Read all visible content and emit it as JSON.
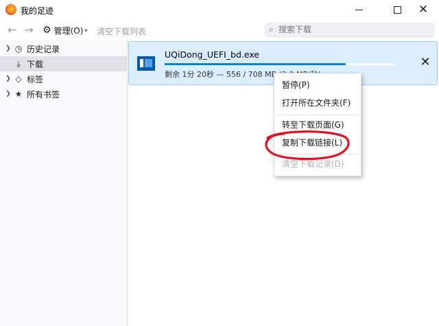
{
  "window": {
    "title": "我的足迹",
    "minimize_symbol": "",
    "close_symbol": "✕"
  },
  "toolbar": {
    "back_symbol": "←",
    "forward_symbol": "→",
    "organize_label": "管理(O)",
    "clear_label": "清空下载列表",
    "search_placeholder": "搜索下载"
  },
  "sidebar": {
    "items": [
      {
        "label": "历史记录",
        "icon": "clock-icon",
        "twisty": true
      },
      {
        "label": "下载",
        "icon": "download-icon",
        "twisty": false,
        "selected": true
      },
      {
        "label": "标签",
        "icon": "tag-icon",
        "twisty": true
      },
      {
        "label": "所有书签",
        "icon": "star-icon",
        "twisty": true
      }
    ]
  },
  "download": {
    "file_name": "UQiDong_UEFI_bd.exe",
    "status": "剩余 1分 20秒 — 556 / 708 MB (2.0 MB/秒)",
    "progress": 0.785
  },
  "context_menu": {
    "items": [
      {
        "label": "暂停(P)",
        "disabled": false
      },
      {
        "label": "打开所在文件夹(F)",
        "disabled": false
      },
      {
        "label": "转至下载页面(G)",
        "disabled": false
      },
      {
        "label": "复制下载链接(L)",
        "disabled": false,
        "annotated": true
      },
      {
        "label": "清空下载记录(D)",
        "disabled": true
      }
    ]
  },
  "colors": {
    "accent": "#0a84d8",
    "selected_row": "#dbeefe",
    "annotation": "#e0101e"
  }
}
